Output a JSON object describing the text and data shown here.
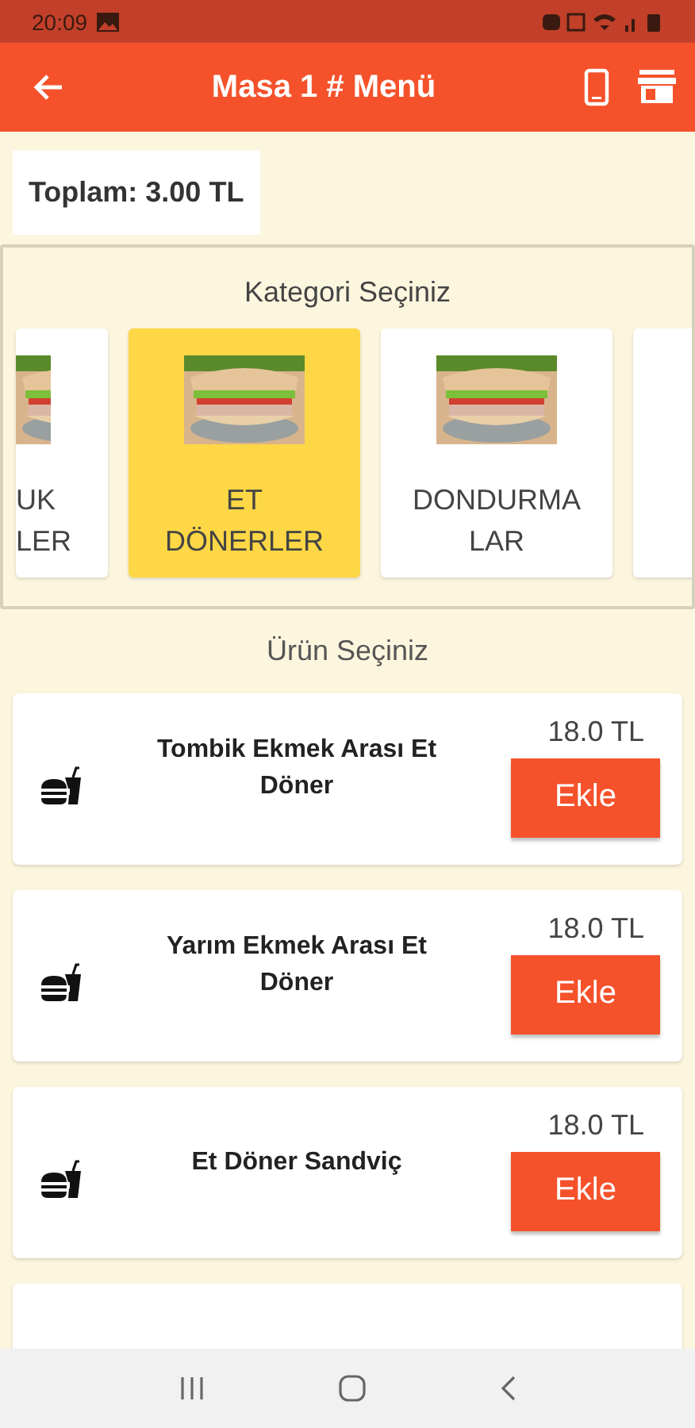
{
  "status_bar": {
    "time": "20:09"
  },
  "app_bar": {
    "title": "Masa 1 # Menü"
  },
  "total": "Toplam: 3.00 TL",
  "category_heading": "Kategori Seçiniz",
  "categories": [
    {
      "kind": "partial_left",
      "lines": [
        "UK",
        "LER"
      ],
      "selected": false
    },
    {
      "kind": "full",
      "lines": [
        "ET",
        "DÖNERLER"
      ],
      "selected": true
    },
    {
      "kind": "full",
      "lines": [
        "DONDURMA",
        "LAR"
      ],
      "selected": false
    },
    {
      "kind": "partial_right",
      "selected": false
    }
  ],
  "product_heading": "Ürün Seçiniz",
  "products": [
    {
      "name": "Tombik Ekmek Arası Et Döner",
      "price": "18.0 TL",
      "button": "Ekle"
    },
    {
      "name": "Yarım Ekmek Arası Et Döner",
      "price": "18.0 TL",
      "button": "Ekle"
    },
    {
      "name": "Et Döner Sandviç",
      "price": "18.0 TL",
      "button": "Ekle"
    },
    {
      "kind": "partial"
    }
  ]
}
